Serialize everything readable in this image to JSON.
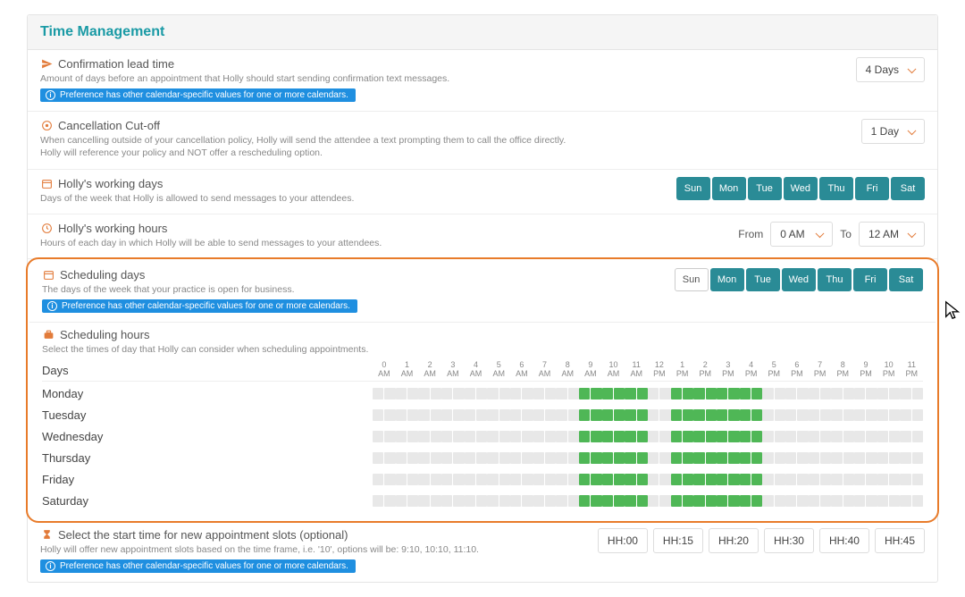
{
  "header": {
    "title": "Time Management"
  },
  "confirmation": {
    "title": "Confirmation lead time",
    "desc": "Amount of days before an appointment that Holly should start sending confirmation text messages.",
    "badge": "Preference has other calendar-specific values for one or more calendars.",
    "value": "4 Days"
  },
  "cancellation": {
    "title": "Cancellation Cut-off",
    "desc": "When cancelling outside of your cancellation policy, Holly will send the attendee a text prompting them to call the office directly. Holly will reference your policy and NOT offer a rescheduling option.",
    "value": "1 Day"
  },
  "workingDays": {
    "title": "Holly's working days",
    "desc": "Days of the week that Holly is allowed to send messages to your attendees.",
    "days": [
      {
        "label": "Sun",
        "on": true
      },
      {
        "label": "Mon",
        "on": true
      },
      {
        "label": "Tue",
        "on": true
      },
      {
        "label": "Wed",
        "on": true
      },
      {
        "label": "Thu",
        "on": true
      },
      {
        "label": "Fri",
        "on": true
      },
      {
        "label": "Sat",
        "on": true
      }
    ]
  },
  "workingHours": {
    "title": "Holly's working hours",
    "desc": "Hours of each day in which Holly will be able to send messages to your attendees.",
    "fromLabel": "From",
    "from": "0 AM",
    "toLabel": "To",
    "to": "12 AM"
  },
  "schedulingDays": {
    "title": "Scheduling days",
    "desc": "The days of the week that your practice is open for business.",
    "badge": "Preference has other calendar-specific values for one or more calendars.",
    "days": [
      {
        "label": "Sun",
        "on": false
      },
      {
        "label": "Mon",
        "on": true
      },
      {
        "label": "Tue",
        "on": true
      },
      {
        "label": "Wed",
        "on": true
      },
      {
        "label": "Thu",
        "on": true
      },
      {
        "label": "Fri",
        "on": true
      },
      {
        "label": "Sat",
        "on": true
      }
    ]
  },
  "schedulingHours": {
    "title": "Scheduling hours",
    "desc": "Select the times of day that Holly can consider when scheduling appointments.",
    "daysLabel": "Days",
    "hours": [
      {
        "num": "0",
        "ampm": "AM"
      },
      {
        "num": "1",
        "ampm": "AM"
      },
      {
        "num": "2",
        "ampm": "AM"
      },
      {
        "num": "3",
        "ampm": "AM"
      },
      {
        "num": "4",
        "ampm": "AM"
      },
      {
        "num": "5",
        "ampm": "AM"
      },
      {
        "num": "6",
        "ampm": "AM"
      },
      {
        "num": "7",
        "ampm": "AM"
      },
      {
        "num": "8",
        "ampm": "AM"
      },
      {
        "num": "9",
        "ampm": "AM"
      },
      {
        "num": "10",
        "ampm": "AM"
      },
      {
        "num": "11",
        "ampm": "AM"
      },
      {
        "num": "12",
        "ampm": "PM"
      },
      {
        "num": "1",
        "ampm": "PM"
      },
      {
        "num": "2",
        "ampm": "PM"
      },
      {
        "num": "3",
        "ampm": "PM"
      },
      {
        "num": "4",
        "ampm": "PM"
      },
      {
        "num": "5",
        "ampm": "PM"
      },
      {
        "num": "6",
        "ampm": "PM"
      },
      {
        "num": "7",
        "ampm": "PM"
      },
      {
        "num": "8",
        "ampm": "PM"
      },
      {
        "num": "9",
        "ampm": "PM"
      },
      {
        "num": "10",
        "ampm": "PM"
      },
      {
        "num": "11",
        "ampm": "PM"
      }
    ],
    "rows": [
      {
        "label": "Monday",
        "on": [
          [
            9,
            12
          ],
          [
            13,
            17
          ]
        ]
      },
      {
        "label": "Tuesday",
        "on": [
          [
            9,
            12
          ],
          [
            13,
            17
          ]
        ]
      },
      {
        "label": "Wednesday",
        "on": [
          [
            9,
            12
          ],
          [
            13,
            17
          ]
        ]
      },
      {
        "label": "Thursday",
        "on": [
          [
            9,
            12
          ],
          [
            13,
            17
          ]
        ]
      },
      {
        "label": "Friday",
        "on": [
          [
            9,
            12
          ],
          [
            13,
            17
          ]
        ]
      },
      {
        "label": "Saturday",
        "on": [
          [
            9,
            12
          ],
          [
            13,
            17
          ]
        ]
      }
    ]
  },
  "startTime": {
    "title": "Select the start time for new appointment slots (optional)",
    "desc": "Holly will offer new appointment slots based on the time frame, i.e. '10', options will be: 9:10, 10:10, 11:10.",
    "badge": "Preference has other calendar-specific values for one or more calendars.",
    "options": [
      "HH:00",
      "HH:15",
      "HH:20",
      "HH:30",
      "HH:40",
      "HH:45"
    ]
  }
}
